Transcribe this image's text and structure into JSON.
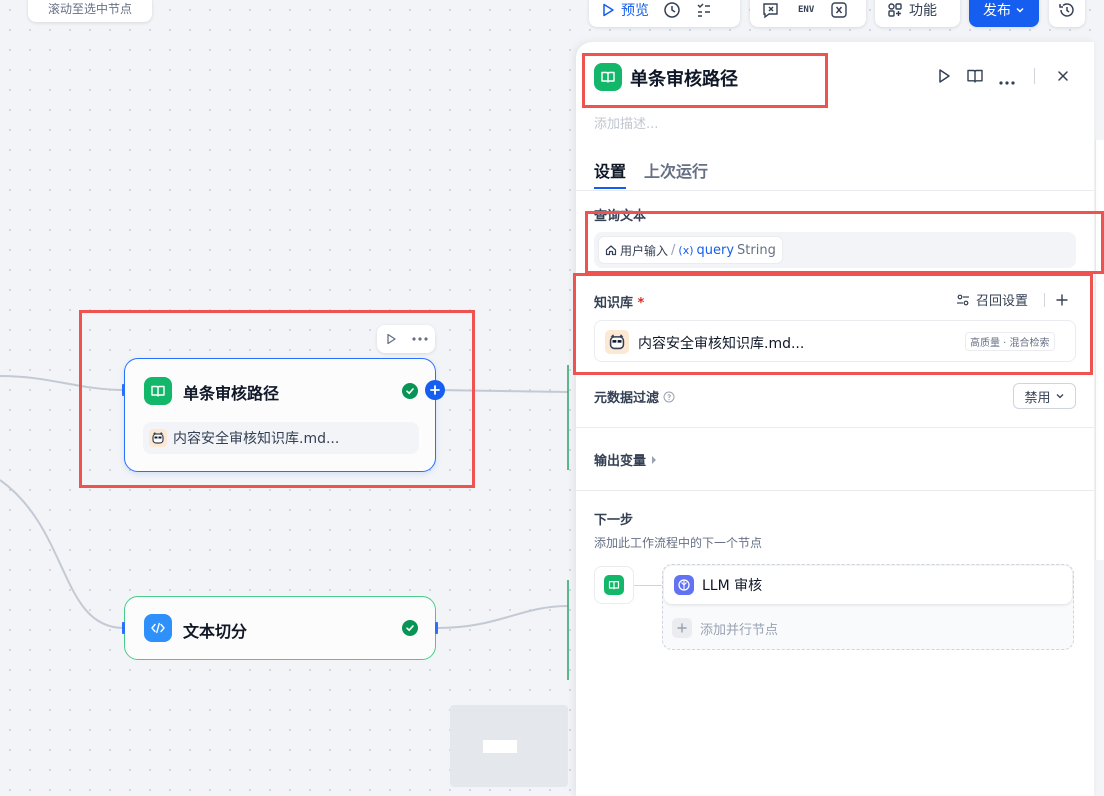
{
  "canvas": {
    "scroll_tooltip": "滚动至选中节点",
    "nodes": [
      {
        "title": "单条审核路径",
        "kb_item": "内容安全审核知识库.md..."
      },
      {
        "title": "文本切分"
      }
    ]
  },
  "toolbar": {
    "preview_label": "预览",
    "env_label": "ENV",
    "features_label": "功能",
    "publish_label": "发布"
  },
  "panel": {
    "title": "单条审核路径",
    "description_placeholder": "添加描述...",
    "tabs": [
      "设置",
      "上次运行"
    ],
    "query": {
      "label": "查询文本",
      "source": "用户输入",
      "separator": "/",
      "var_prefix": "(x)",
      "var_name": "query",
      "var_type": "String"
    },
    "knowledge": {
      "label": "知识库",
      "required_mark": "*",
      "recall_settings": "召回设置",
      "item_name": "内容安全审核知识库.md...",
      "item_badge": "高质量 · 混合检索"
    },
    "metadata_filter": {
      "label": "元数据过滤",
      "value": "禁用"
    },
    "output_vars": {
      "label": "输出变量"
    },
    "next_step": {
      "title": "下一步",
      "subtitle": "添加此工作流程中的下一个节点",
      "next_node": "LLM 审核",
      "add_parallel": "添加并行节点"
    }
  },
  "colors": {
    "accent": "#155eef",
    "knowledge_green": "#12b76a",
    "success": "#079455",
    "highlight_red": "#ef5350",
    "code_blue": "#2e90fa",
    "llm_purple": "#6172f3"
  }
}
